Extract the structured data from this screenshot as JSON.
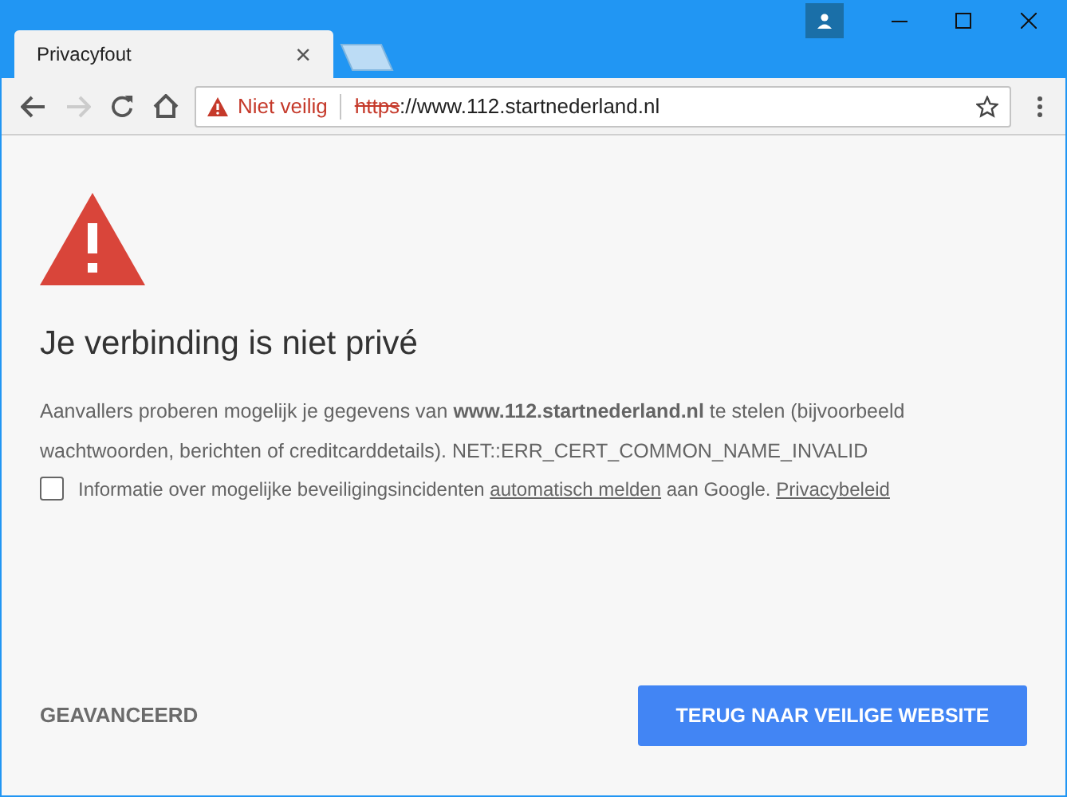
{
  "tabs": [
    {
      "title": "Privacyfout",
      "close": "×",
      "selected": true
    }
  ],
  "address_bar": {
    "security_label": "Niet veilig",
    "scheme": "https",
    "url_rest": "://www.112.startnederland.nl",
    "scheme_struck": true
  },
  "page": {
    "heading": "Je verbinding is niet privé",
    "description": "Aanvallers proberen mogelijk je gegevens van **www.112.startnederland.nl** te stelen (bijvoorbeeld wachtwoorden, berichten of creditcarddetails). NET::ERR_CERT_COMMON_NAME_INVALID",
    "report_checkbox": {
      "checked": false,
      "text_before": "Informatie over mogelijke beveiligingsincidenten",
      "link": "automatisch melden",
      "text_after": "aan Google.",
      "privacy_link": "Privacybeleid"
    },
    "advanced_button": "GEAVANCEERD",
    "back_button": "TERUG NAAR VEILIGE WEBSITE"
  }
}
